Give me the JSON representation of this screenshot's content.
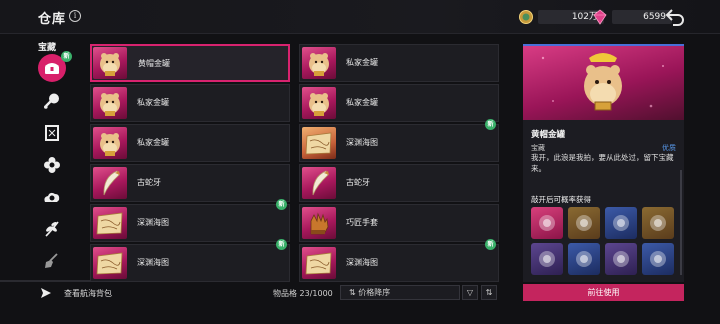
{
  "header": {
    "title": "仓库",
    "currency_1": {
      "icon": "game-coin-icon",
      "value": "102万"
    },
    "currency_2": {
      "icon": "pink-gem-icon",
      "value": "6599"
    },
    "back_icon": "back-arrow-icon"
  },
  "sidebar": {
    "category_label": "宝藏",
    "new_badge": "新",
    "items": [
      {
        "icon": "treasure-chest-icon",
        "active": true,
        "new": true
      },
      {
        "icon": "drumstick-icon",
        "active": false,
        "new": false
      },
      {
        "icon": "card-frame-icon",
        "active": false,
        "new": false
      },
      {
        "icon": "flower-emblem-icon",
        "active": false,
        "new": false
      },
      {
        "icon": "cloud-gear-icon",
        "active": false,
        "new": false
      },
      {
        "icon": "leaf-branch-icon",
        "active": false,
        "new": false
      },
      {
        "icon": "shovel-icon",
        "active": false,
        "new": false
      }
    ]
  },
  "grid": {
    "items": [
      {
        "name": "黄帽金罐",
        "thumb": "hamster-pot",
        "color": "pink",
        "selected": true,
        "new": false
      },
      {
        "name": "私家金罐",
        "thumb": "hamster-pot",
        "color": "pink",
        "selected": false,
        "new": false
      },
      {
        "name": "私家金罐",
        "thumb": "hamster-pot",
        "color": "pink",
        "selected": false,
        "new": false
      },
      {
        "name": "私家金罐",
        "thumb": "hamster-pot",
        "color": "pink",
        "selected": false,
        "new": false
      },
      {
        "name": "私家金罐",
        "thumb": "hamster-pot",
        "color": "pink",
        "selected": false,
        "new": false
      },
      {
        "name": "深渊海图",
        "thumb": "sea-map",
        "color": "orange",
        "selected": false,
        "new": true
      },
      {
        "name": "古蛇牙",
        "thumb": "snake-fang",
        "color": "pink",
        "selected": false,
        "new": false
      },
      {
        "name": "古蛇牙",
        "thumb": "snake-fang",
        "color": "pink",
        "selected": false,
        "new": false
      },
      {
        "name": "深渊海图",
        "thumb": "sea-map",
        "color": "pink",
        "selected": false,
        "new": true
      },
      {
        "name": "巧匠手套",
        "thumb": "gauntlet",
        "color": "pink",
        "selected": false,
        "new": false
      },
      {
        "name": "深渊海图",
        "thumb": "sea-map",
        "color": "pink",
        "selected": false,
        "new": true
      },
      {
        "name": "深渊海图",
        "thumb": "sea-map",
        "color": "pink",
        "selected": false,
        "new": true
      }
    ]
  },
  "bottom_bar": {
    "view_bag_label": "查看航海背包",
    "count_label": "物品格 23/1000",
    "sort_label": "价格降序",
    "sort_icon": "sort-arrows-icon",
    "filter_icon": "filter-icon",
    "order_icon": "order-toggle-icon"
  },
  "detail": {
    "name": "黄帽金罐",
    "type": "宝藏",
    "quality": "优质",
    "description": "我开，此浪是我拍，要从此处过，留下宝藏来。",
    "rewards_title": "敲开后可概率获得",
    "rewards": [
      {
        "icon": "pink-snake-gem-icon",
        "color": "pink"
      },
      {
        "icon": "golden-scepter-icon",
        "color": "gold"
      },
      {
        "icon": "blue-blaster-icon",
        "color": "blue"
      },
      {
        "icon": "chest-bag-icon",
        "color": "gold"
      },
      {
        "icon": "pearl-cluster-icon",
        "color": "purple"
      },
      {
        "icon": "silver-orbs-icon",
        "color": "blue"
      },
      {
        "icon": "purple-ring-icon",
        "color": "purple"
      },
      {
        "icon": "amulet-icon",
        "color": "blue"
      }
    ],
    "use_button": "前往使用"
  },
  "colors": {
    "accent": "#d8236f",
    "new_badge": "#3ab06a",
    "quality_blue": "#5a9cf0",
    "header_blue_line": "#4a6fd8"
  }
}
